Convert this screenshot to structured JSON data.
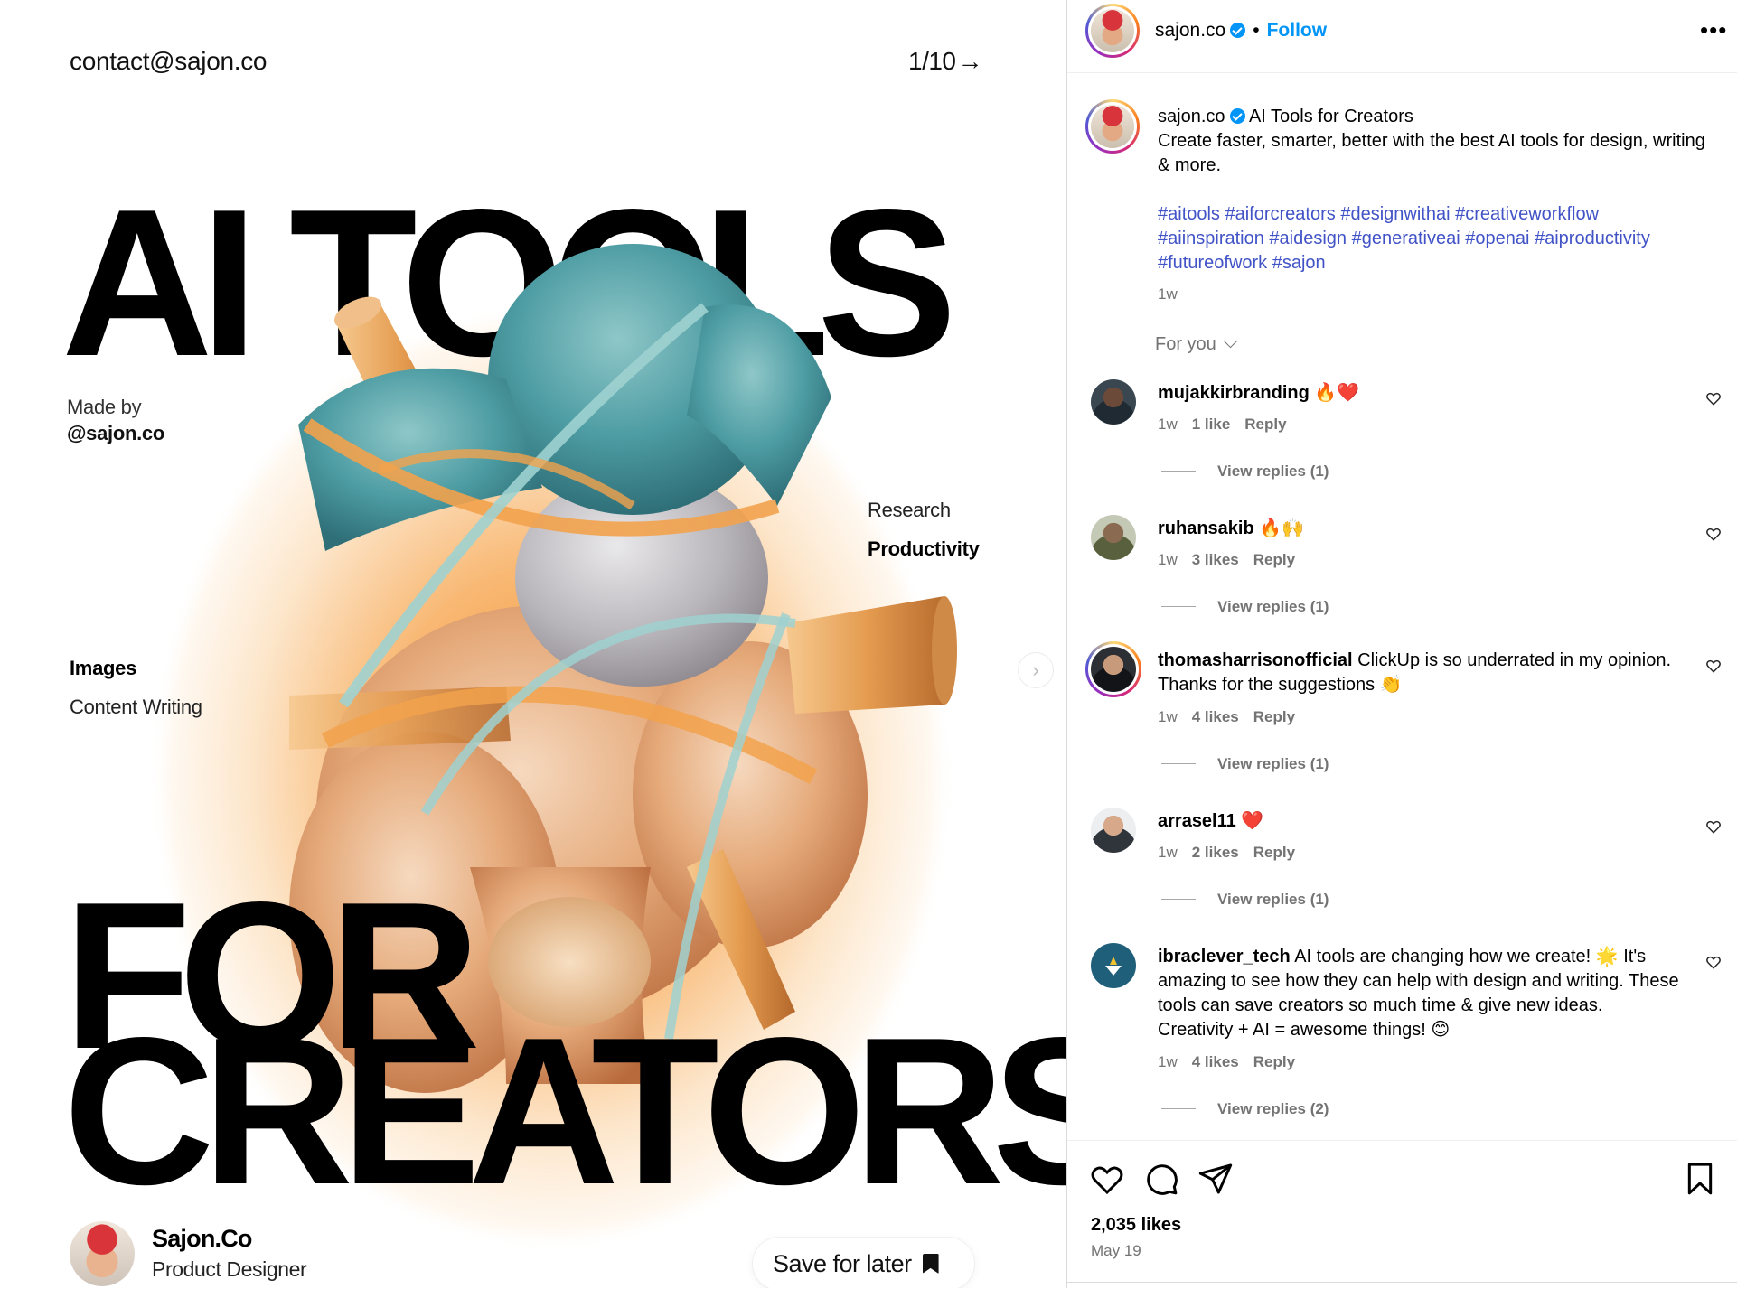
{
  "post": {
    "contact": "contact@sajon.co",
    "pager": "1/10",
    "headline_ai": "AI",
    "headline_tools": "TOOLS",
    "headline_for": "FOR",
    "headline_creators": "CREATORS",
    "made_by": "Made by",
    "made_by_handle": "@sajon.co",
    "labels": {
      "research": "Research",
      "productivity": "Productivity",
      "images": "Images",
      "content_writing": "Content Writing"
    },
    "author_name": "Sajon.Co",
    "author_role": "Product Designer",
    "save_label": "Save for later"
  },
  "header": {
    "username": "sajon.co",
    "separator": "•",
    "follow": "Follow",
    "more": "•••"
  },
  "caption": {
    "username": "sajon.co",
    "title": "AI Tools for Creators",
    "text": "Create faster, smarter, better with the best AI tools for design, writing & more.",
    "hashtags": "#aitools #aiforcreators #designwithai #creativeworkflow #aiinspiration #aidesign #generativeai #openai #aiproductivity #futureofwork #sajon",
    "time": "1w"
  },
  "filter": {
    "label": "For you"
  },
  "comments": [
    {
      "user": "mujakkirbranding",
      "text": "🔥❤️",
      "time": "1w",
      "likes": "1 like",
      "reply": "Reply",
      "view_replies": "View replies (1)"
    },
    {
      "user": "ruhansakib",
      "text": "🔥🙌",
      "time": "1w",
      "likes": "3 likes",
      "reply": "Reply",
      "view_replies": "View replies (1)"
    },
    {
      "user": "thomasharrisonofficial",
      "text": "ClickUp is so underrated in my opinion. Thanks for the suggestions 👏",
      "time": "1w",
      "likes": "4 likes",
      "reply": "Reply",
      "view_replies": "View replies (1)"
    },
    {
      "user": "arrasel11",
      "text": "❤️",
      "time": "1w",
      "likes": "2 likes",
      "reply": "Reply",
      "view_replies": "View replies (1)"
    },
    {
      "user": "ibraclever_tech",
      "text": "AI tools are changing how we create! 🌟 It's amazing to see how they can help with design and writing. These tools can save creators so much time & give new ideas. Creativity + AI = awesome things! 😊",
      "time": "1w",
      "likes": "4 likes",
      "reply": "Reply",
      "view_replies": "View replies (2)"
    }
  ],
  "footer": {
    "likes": "2,035 likes",
    "date": "May 19"
  },
  "colors": {
    "accent_blue": "#0095f6",
    "hashtag": "#4153c6",
    "muted": "#737373",
    "glow_orange": "#f48b26",
    "sculpture_teal": "#4e9da4"
  },
  "icons": [
    "chevron-right-icon",
    "bookmark-icon",
    "verified-icon",
    "more-icon",
    "chevron-down-icon",
    "heart-icon",
    "comment-icon",
    "share-icon",
    "save-icon"
  ]
}
